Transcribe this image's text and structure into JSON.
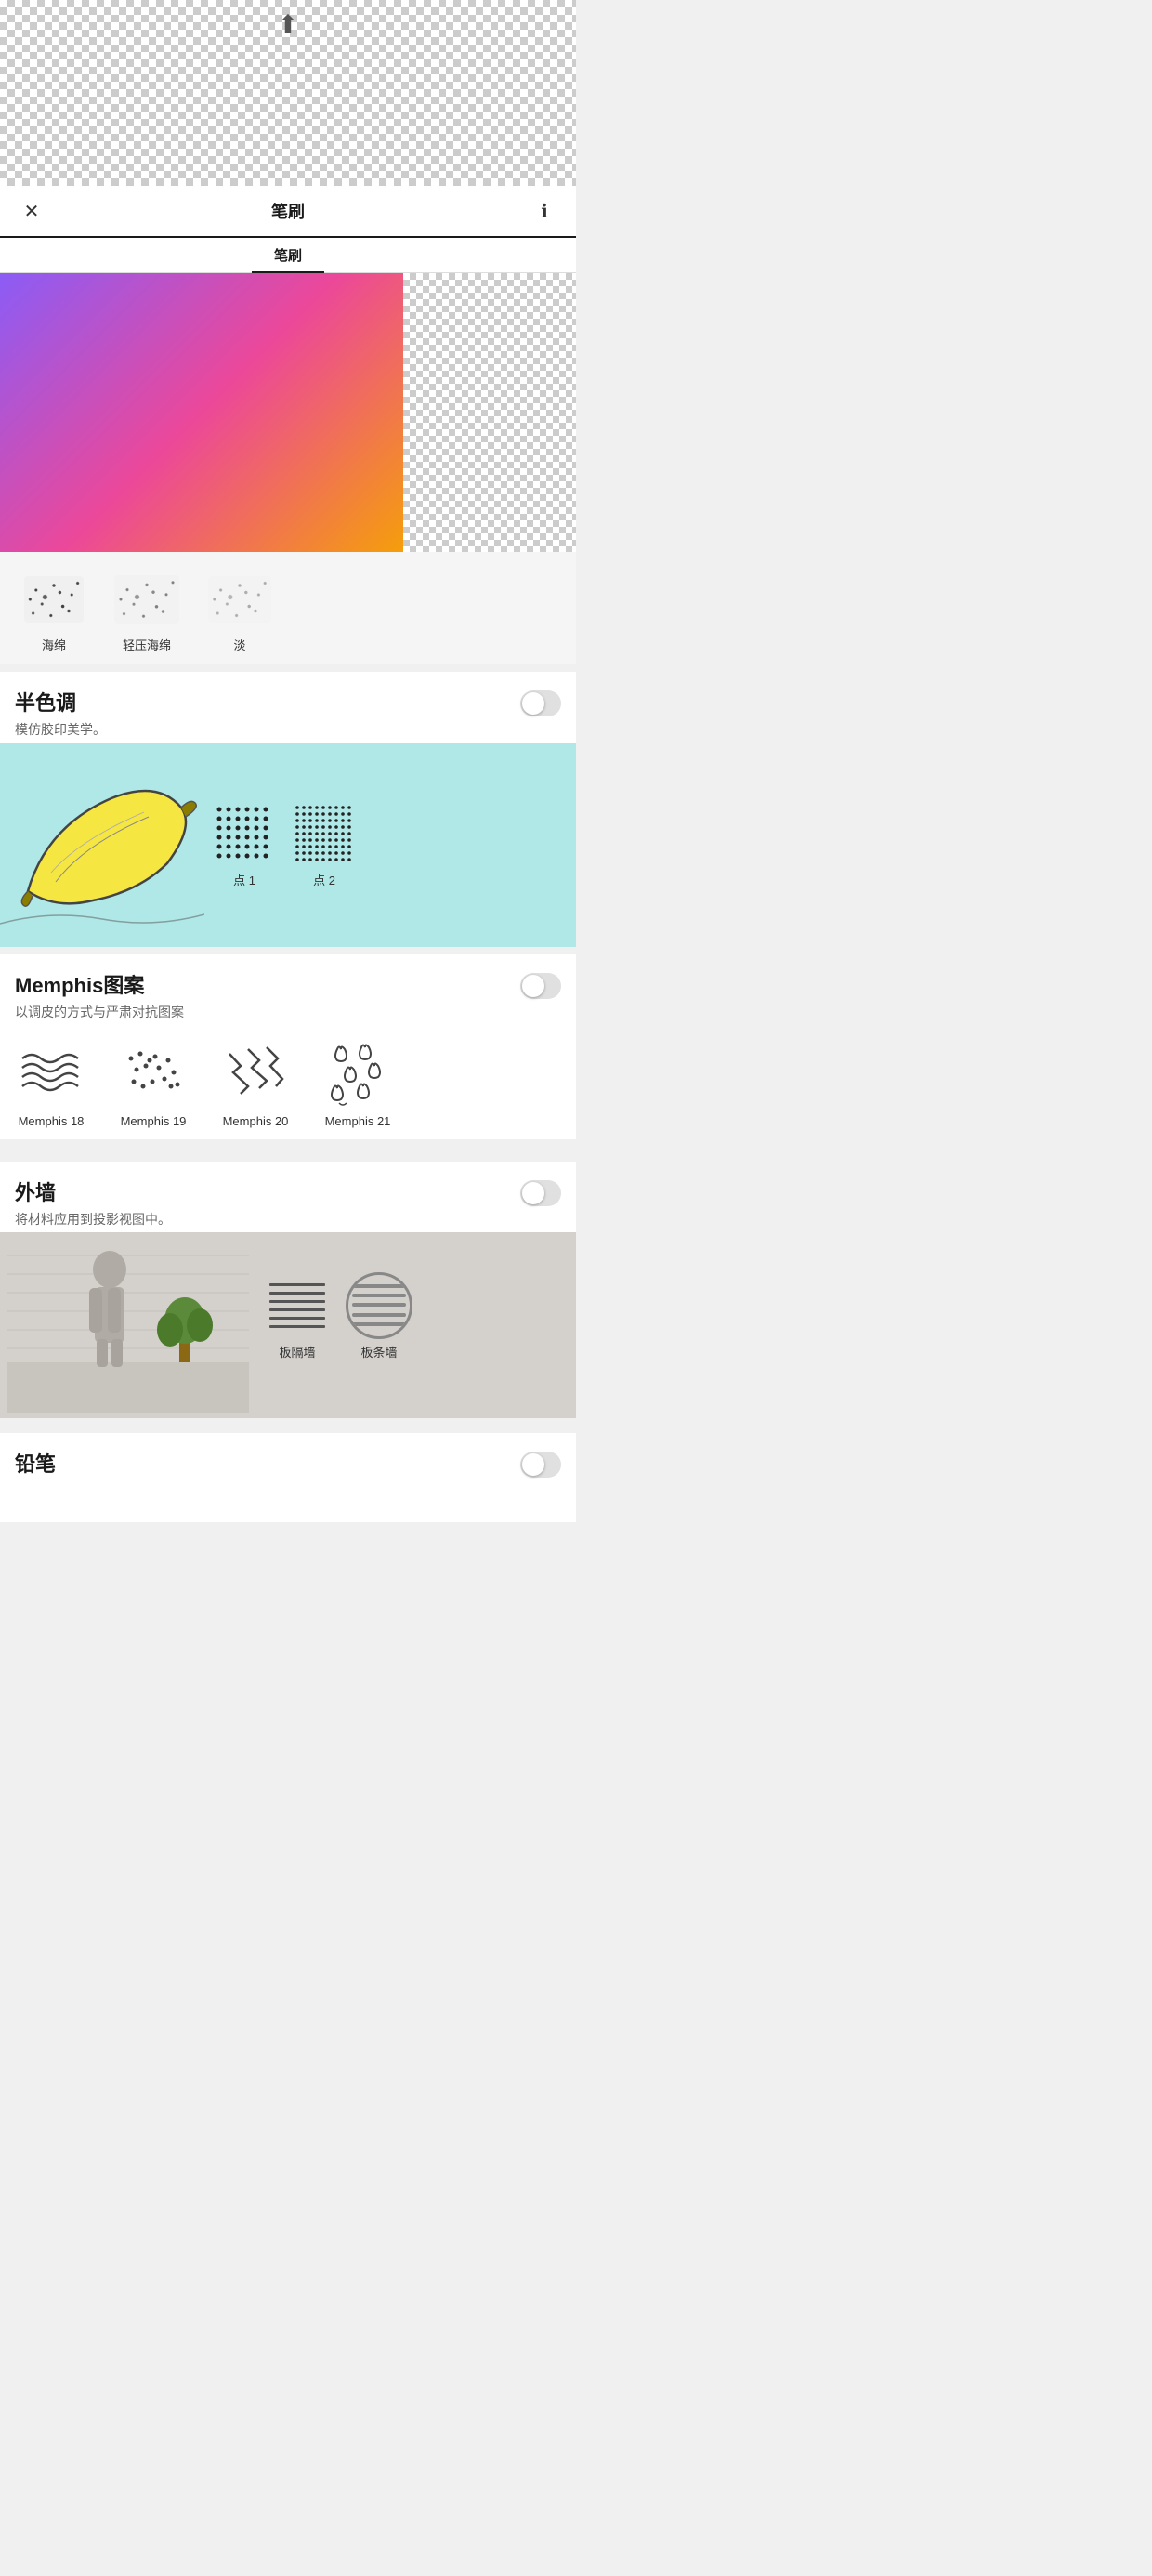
{
  "toolbar": {
    "title": "笔刷",
    "close_label": "✕",
    "info_label": "ℹ"
  },
  "tabs": [
    {
      "label": "笔刷",
      "active": true
    }
  ],
  "sections": {
    "halftone": {
      "title": "半色调",
      "subtitle": "模仿胶印美学。",
      "brushes": [
        {
          "id": "dot1",
          "label": "点 1"
        },
        {
          "id": "dot2",
          "label": "点 2"
        }
      ]
    },
    "memphis": {
      "title": "Memphis图案",
      "subtitle": "以调皮的方式与严肃对抗图案",
      "brushes": [
        {
          "id": "m18",
          "label": "Memphis 18"
        },
        {
          "id": "m19",
          "label": "Memphis 19"
        },
        {
          "id": "m20",
          "label": "Memphis 20"
        },
        {
          "id": "m21",
          "label": "Memphis 21"
        }
      ]
    },
    "outer_wall": {
      "title": "外墙",
      "subtitle": "将材料应用到投影视图中。",
      "brushes": [
        {
          "id": "partition",
          "label": "板隔墙"
        },
        {
          "id": "slat",
          "label": "板条墙"
        }
      ]
    },
    "pencil": {
      "title": "铅笔"
    }
  },
  "sponge_brushes": [
    {
      "id": "sponge1",
      "label": "海绵"
    },
    {
      "id": "sponge2",
      "label": "轻压海绵"
    },
    {
      "id": "sponge3",
      "label": "淡"
    }
  ]
}
